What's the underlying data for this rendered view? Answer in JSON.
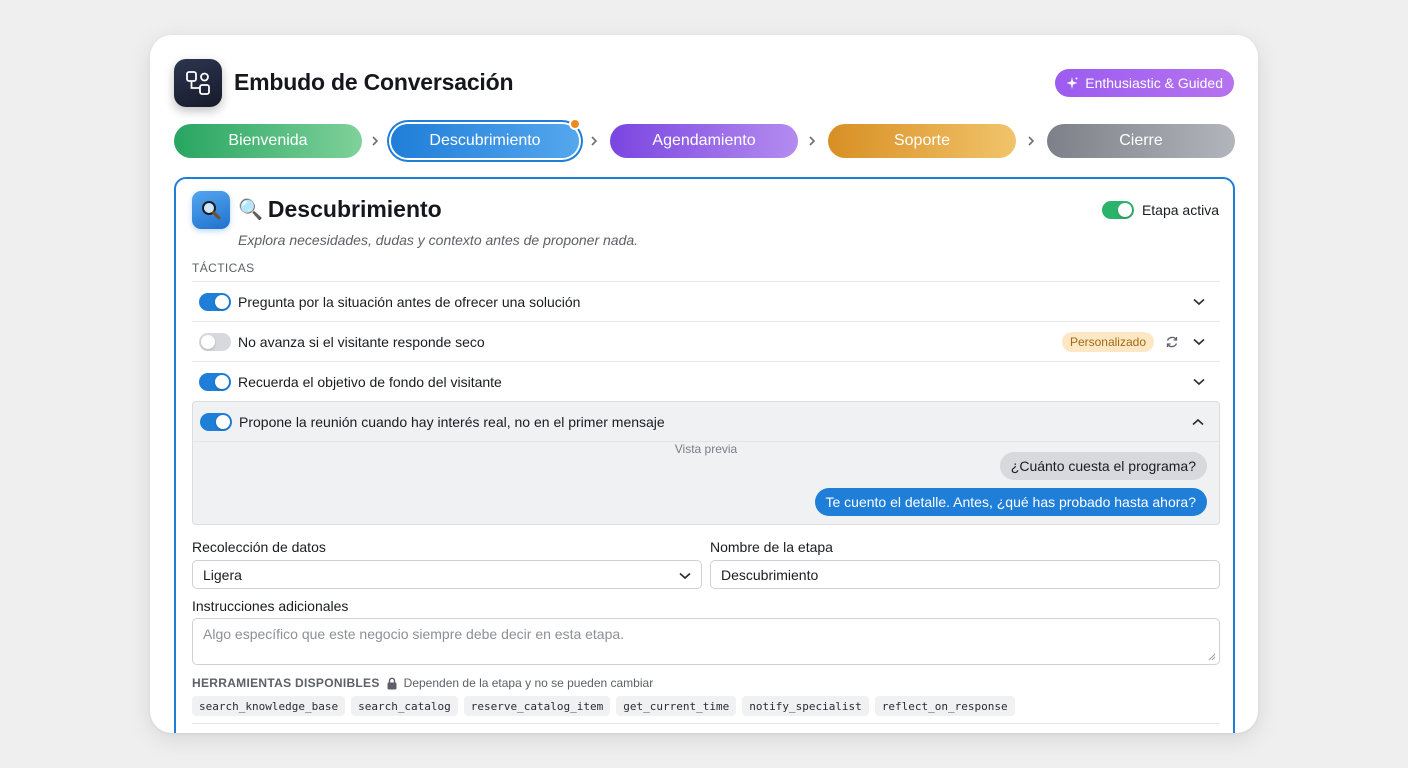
{
  "header": {
    "title": "Embudo de Conversación",
    "app_icon": "flow-shapes-icon",
    "persona": {
      "label": "Enthusiastic & Guided",
      "icon": "sparkle-icon"
    }
  },
  "stages": [
    {
      "label": "Bienvenida",
      "color": "#27a561"
    },
    {
      "label": "Descubrimiento",
      "color": "#1f7ed8",
      "selected": true,
      "unsaved": true
    },
    {
      "label": "Agendamiento",
      "color": "#7a45e0"
    },
    {
      "label": "Soporte",
      "color": "#d88f24"
    },
    {
      "label": "Cierre",
      "color": "#7d8088"
    }
  ],
  "detail": {
    "icon": "magnifier-icon",
    "emoji": "🔍",
    "title": "Descubrimiento",
    "description": "Explora necesidades, dudas y contexto antes de proponer nada.",
    "active_label": "Etapa activa",
    "active": true,
    "tactics_label": "TÁCTICAS",
    "tactics": [
      {
        "text": "Pregunta por la situación antes de ofrecer una solución",
        "enabled": true
      },
      {
        "text": "No avanza si el visitante responde seco",
        "enabled": false,
        "badge": "Personalizado"
      },
      {
        "text": "Recuerda el objetivo de fondo del visitante",
        "enabled": true
      },
      {
        "text": "Propone la reunión cuando hay interés real, no en el primer mensaje",
        "enabled": true,
        "expanded": true
      }
    ],
    "preview": {
      "label": "Vista previa",
      "user_message": "¿Cuánto cuesta el programa?",
      "bot_message": "Te cuento el detalle. Antes, ¿qué has probado hasta ahora?"
    },
    "data_collection": {
      "label": "Recolección de datos",
      "value": "Ligera"
    },
    "stage_name": {
      "label": "Nombre de la etapa",
      "value": "Descubrimiento"
    },
    "instructions": {
      "label": "Instrucciones adicionales",
      "placeholder": "Algo específico que este negocio siempre debe decir en esta etapa."
    },
    "tools": {
      "label": "HERRAMIENTAS DISPONIBLES",
      "note": "Dependen de la etapa y no se pueden cambiar",
      "items": [
        "search_knowledge_base",
        "search_catalog",
        "reserve_catalog_item",
        "get_current_time",
        "notify_specialist",
        "reflect_on_response"
      ]
    }
  }
}
